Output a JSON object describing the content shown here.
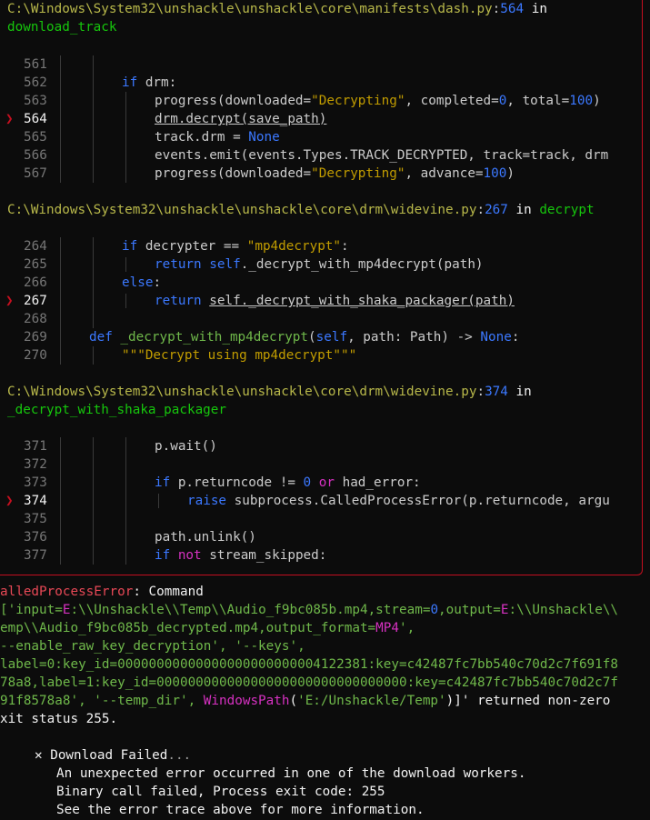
{
  "frame1": {
    "loc_path": "C:\\Windows\\System32\\unshackle\\unshackle\\core\\manifests\\dash.py",
    "loc_sep": ":",
    "loc_line": "564",
    "loc_in": " in",
    "loc_func": "download_track",
    "lines": [
      {
        "n": "561"
      },
      {
        "n": "562"
      },
      {
        "n": "563"
      },
      {
        "n": "564"
      },
      {
        "n": "565"
      },
      {
        "n": "566"
      },
      {
        "n": "567"
      }
    ],
    "code": {
      "l562_kw": "if",
      "l562_rest": " drm:",
      "l563_a": "progress(downloaded=",
      "l563_s": "\"Decrypting\"",
      "l563_b": ", completed=",
      "l563_n1": "0",
      "l563_c": ", total=",
      "l563_n2": "100",
      "l563_d": ")",
      "l564": "drm.decrypt(save_path)",
      "l565_a": "track.drm = ",
      "l565_none": "None",
      "l566": "events.emit(events.Types.TRACK_DECRYPTED, track=track, drm",
      "l567_a": "progress(downloaded=",
      "l567_s": "\"Decrypting\"",
      "l567_b": ", advance=",
      "l567_n": "100",
      "l567_c": ")"
    }
  },
  "frame2": {
    "loc_path": "C:\\Windows\\System32\\unshackle\\unshackle\\core\\drm\\widevine.py",
    "loc_sep": ":",
    "loc_line": "267",
    "loc_in": " in ",
    "loc_func": "decrypt",
    "lines": [
      {
        "n": "264"
      },
      {
        "n": "265"
      },
      {
        "n": "266"
      },
      {
        "n": "267"
      },
      {
        "n": "268"
      },
      {
        "n": "269"
      },
      {
        "n": "270"
      }
    ],
    "code": {
      "l264_kw": "if",
      "l264_a": " decrypter == ",
      "l264_s": "\"mp4decrypt\"",
      "l264_b": ":",
      "l265_kw": "return",
      "l265_self": " self",
      "l265_rest": "._decrypt_with_mp4decrypt(path)",
      "l266_kw": "else",
      "l266_b": ":",
      "l267_kw": "return",
      "l267_call": "self._decrypt_with_shaka_packager(path)",
      "l269_kw": "def",
      "l269_fn": " _decrypt_with_mp4decrypt",
      "l269_a": "(",
      "l269_self": "self",
      "l269_b": ", path: Path) -> ",
      "l269_none": "None",
      "l269_c": ":",
      "l270_s": "\"\"\"Decrypt using mp4decrypt\"\"\""
    }
  },
  "frame3": {
    "loc_path": "C:\\Windows\\System32\\unshackle\\unshackle\\core\\drm\\widevine.py",
    "loc_sep": ":",
    "loc_line": "374",
    "loc_in": " in",
    "loc_func": "_decrypt_with_shaka_packager",
    "lines": [
      {
        "n": "371"
      },
      {
        "n": "372"
      },
      {
        "n": "373"
      },
      {
        "n": "374"
      },
      {
        "n": "375"
      },
      {
        "n": "376"
      },
      {
        "n": "377"
      }
    ],
    "code": {
      "l371": "p.wait()",
      "l373_kw": "if",
      "l373_a": " p.returncode != ",
      "l373_n": "0",
      "l373_or": " or",
      "l373_b": " had_error:",
      "l374_kw": "raise",
      "l374_rest": " subprocess.CalledProcessError(p.returncode, argu",
      "l376": "path.unlink()",
      "l377_kw": "if",
      "l377_not": " not",
      "l377_b": " stream_skipped:"
    }
  },
  "cursor_marker": "❯",
  "error": {
    "type": "alledProcessError",
    "colon": ": ",
    "command": "Command",
    "l1_a": "['input=",
    "l1_e1": "E",
    "l1_b": ":\\\\Unshackle\\\\Temp\\\\Audio_f9bc085b.mp4,stream=",
    "l1_n": "0",
    "l1_c": ",output=",
    "l1_e2": "E",
    "l1_d": ":\\\\Unshackle\\\\",
    "l2_a": "emp\\\\Audio_f9bc085b_decrypted.mp4,output_format=",
    "l2_m": "MP4",
    "l2_b": "',",
    "l3": "--enable_raw_key_decryption', '--keys',",
    "l4": "label=0:key_id=00000000000000000000000004122381:key=c42487fc7bb540c70d2c7f691f8",
    "l5": "78a8,label=1:key_id=00000000000000000000000000000000:key=c42487fc7bb540c70d2c7f",
    "l6_a": "91f8578a8', '--temp_dir', ",
    "l6_w": "WindowsPath",
    "l6_p1": "(",
    "l6_s": "'E:/Unshackle/Temp'",
    "l6_p2": ")",
    "l6_b": "]' returned non-zero",
    "l7": "xit status 255."
  },
  "failure": {
    "icon": "✕",
    "title": "Download Failed",
    "ellipsis": "...",
    "msg1": "An unexpected error occurred in one of the download workers.",
    "msg2": "Binary call failed, Process exit code: 255",
    "msg3": "See the error trace above for more information."
  }
}
